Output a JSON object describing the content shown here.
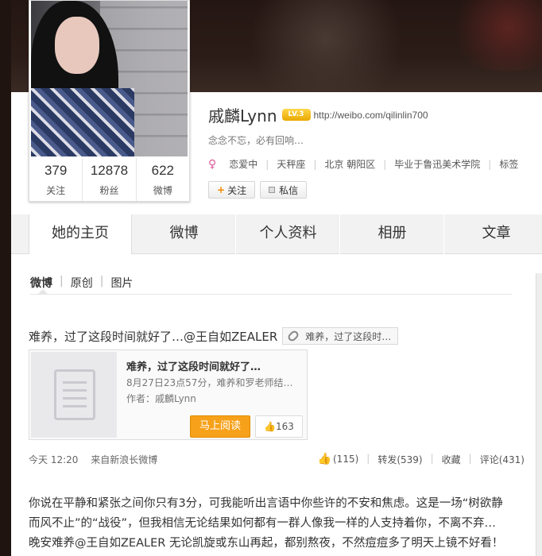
{
  "profile": {
    "name": "戚麟Lynn",
    "level_badge": "LV.3",
    "url": "http://weibo.com/qilinlin700",
    "motto": "念念不忘，必有回响…",
    "gender_icon": "female-icon",
    "tags": [
      "恋爱中",
      "天秤座",
      "北京 朝阳区",
      "毕业于鲁迅美术学院",
      "标签"
    ],
    "follow_label": "关注",
    "message_label": "私信",
    "stats": [
      {
        "num": "379",
        "label": "关注"
      },
      {
        "num": "12878",
        "label": "粉丝"
      },
      {
        "num": "622",
        "label": "微博"
      }
    ]
  },
  "tabs": [
    {
      "label": "她的主页",
      "active": true
    },
    {
      "label": "微博"
    },
    {
      "label": "个人资料"
    },
    {
      "label": "相册"
    },
    {
      "label": "文章"
    }
  ],
  "subnav": [
    "微博",
    "原创",
    "图片"
  ],
  "post": {
    "text": "难养，过了这段时间就好了…@王自如ZEALER",
    "link_card": "难养，过了这段时…",
    "article": {
      "title": "难养，过了这段时间就好了…",
      "meta": "8月27日23点57分，难养和罗老师结…",
      "author": "作者：戚麟Lynn",
      "read_label": "马上阅读",
      "likes": "163"
    },
    "time": "今天 12:20",
    "source": "来自新浪长微博",
    "like_count": "(115)",
    "repost": "转发(539)",
    "favorite": "收藏",
    "comment": "评论(431)"
  },
  "post2": {
    "text": "你说在平静和紧张之间你只有3分，可我能听出言语中你些许的不安和焦虑。这是一场“树欲静而风不止”的“战役”，但我相信无论结果如何都有一群人像我一样的人支持着你，不离不弃…晚安难养@王自如ZEALER 无论凯旋或东山再起，都别熬夜，不然痘痘多了明天上镜不好看！"
  },
  "colors": {
    "accent_orange": "#f7a11a",
    "female": "#e05a9b",
    "link_blue": "#4a8bd6"
  }
}
